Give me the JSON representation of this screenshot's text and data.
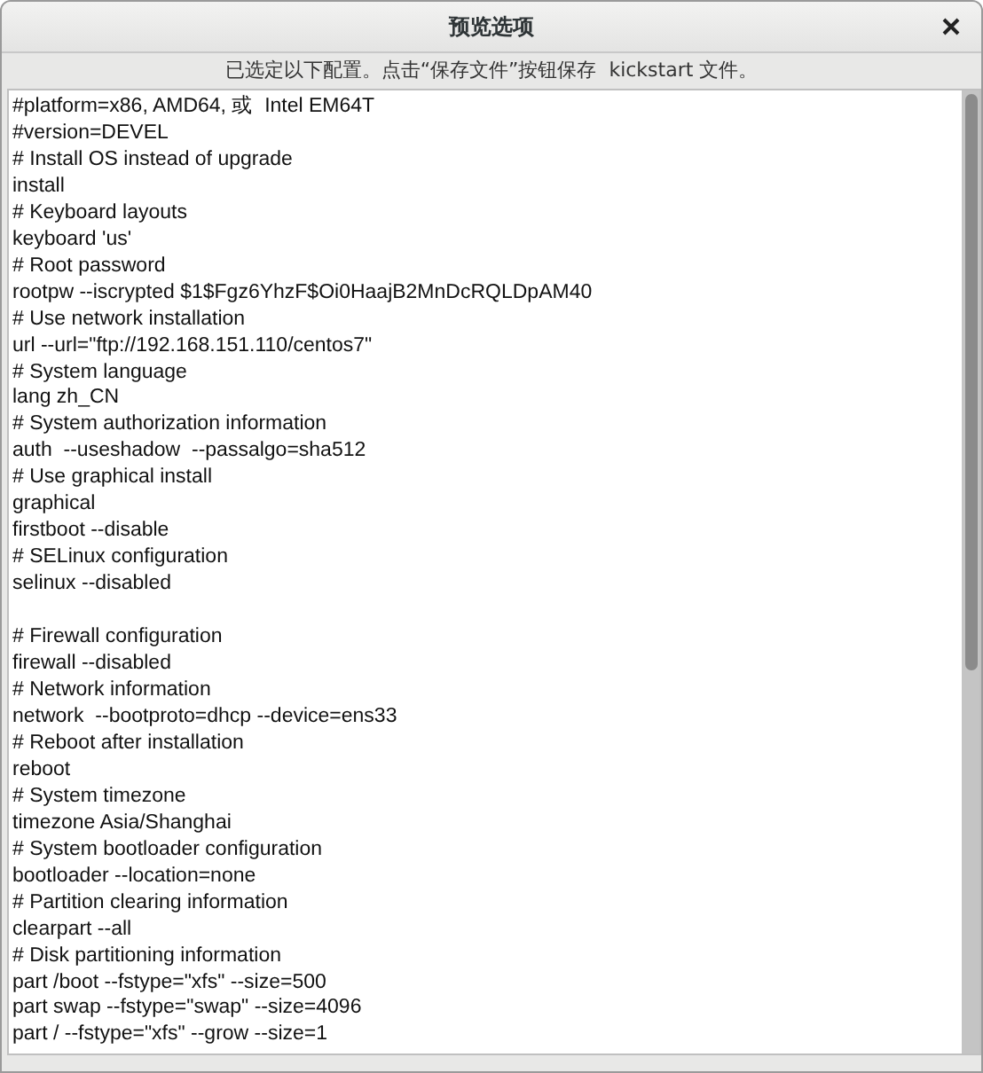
{
  "window": {
    "title": "预览选项"
  },
  "message": "已选定以下配置。点击“保存文件”按钮保存  kickstart 文件。",
  "editor": {
    "blocks": [
      [
        "#platform=x86, AMD64, 或  Intel EM64T",
        "#version=DEVEL",
        "# Install OS instead of upgrade",
        "install",
        "# Keyboard layouts",
        "keyboard 'us'",
        "# Root password",
        "rootpw --iscrypted $1$Fgz6YhzF$Oi0HaajB2MnDcRQLDpAM40",
        "# Use network installation",
        "url --url=\"ftp://192.168.151.110/centos7\"",
        "# System language",
        "lang zh_CN",
        "# System authorization information",
        "auth  --useshadow  --passalgo=sha512",
        "# Use graphical install",
        "graphical",
        "firstboot --disable",
        "# SELinux configuration",
        "selinux --disabled"
      ],
      [
        "# Firewall configuration",
        "firewall --disabled",
        "# Network information",
        "network  --bootproto=dhcp --device=ens33",
        "# Reboot after installation",
        "reboot",
        "# System timezone",
        "timezone Asia/Shanghai",
        "# System bootloader configuration",
        "bootloader --location=none",
        "# Partition clearing information",
        "clearpart --all",
        "# Disk partitioning information",
        "part /boot --fstype=\"xfs\" --size=500",
        "part swap --fstype=\"swap\" --size=4096",
        "part / --fstype=\"xfs\" --grow --size=1"
      ]
    ]
  }
}
